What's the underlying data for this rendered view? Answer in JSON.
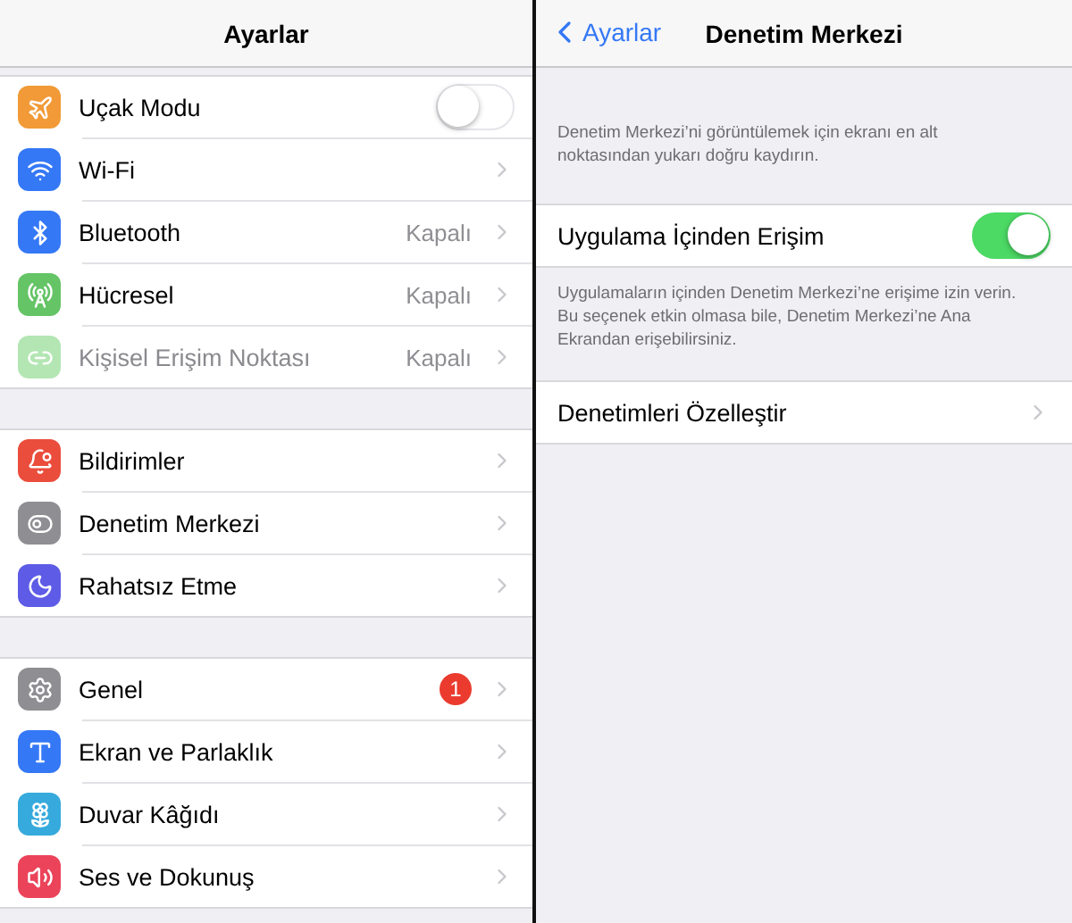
{
  "left": {
    "title": "Ayarlar",
    "groups": [
      {
        "rows": [
          {
            "kind": "toggle",
            "label": "Uçak Modu",
            "color": "#f19a37",
            "on": false,
            "disabled": false
          },
          {
            "kind": "link",
            "label": "Wi-Fi",
            "color": "#3478f6",
            "disabled": false
          },
          {
            "kind": "link",
            "label": "Bluetooth",
            "color": "#3478f6",
            "value": "Kapalı",
            "disabled": false
          },
          {
            "kind": "link",
            "label": "Hücresel",
            "color": "#65c466",
            "value": "Kapalı",
            "disabled": false
          },
          {
            "kind": "link",
            "label": "Kişisel Erişim Noktası",
            "color": "#b3e6b3",
            "value": "Kapalı",
            "disabled": true
          }
        ]
      },
      {
        "rows": [
          {
            "kind": "link",
            "label": "Bildirimler",
            "color": "#eb4d3d",
            "disabled": false
          },
          {
            "kind": "link",
            "label": "Denetim Merkezi",
            "color": "#8e8e93",
            "disabled": false
          },
          {
            "kind": "link",
            "label": "Rahatsız Etme",
            "color": "#5e5ce6",
            "disabled": false
          }
        ]
      },
      {
        "rows": [
          {
            "kind": "link",
            "label": "Genel",
            "color": "#8e8e93",
            "badge": "1",
            "disabled": false
          },
          {
            "kind": "link",
            "label": "Ekran ve Parlaklık",
            "color": "#3478f6",
            "disabled": false
          },
          {
            "kind": "link",
            "label": "Duvar Kâğıdı",
            "color": "#36aadc",
            "disabled": false
          },
          {
            "kind": "link",
            "label": "Ses ve Dokunuş",
            "color": "#eb445a",
            "disabled": false
          }
        ]
      }
    ]
  },
  "right": {
    "back": "Ayarlar",
    "title": "Denetim Merkezi",
    "note": "Denetim Merkezi’ni görüntülemek için ekranı en alt noktasından yukarı doğru kaydırın.",
    "sections": [
      {
        "kind": "toggle",
        "label": "Uygulama İçinden Erişim",
        "on": true,
        "footer": "Uygulamaların içinden Denetim Merkezi’ne erişime izin verin. Bu seçenek etkin olmasa bile, Denetim Merkezi’ne Ana Ekrandan erişebilirsiniz."
      },
      {
        "kind": "link",
        "label": "Denetimleri Özelleştir"
      }
    ]
  }
}
